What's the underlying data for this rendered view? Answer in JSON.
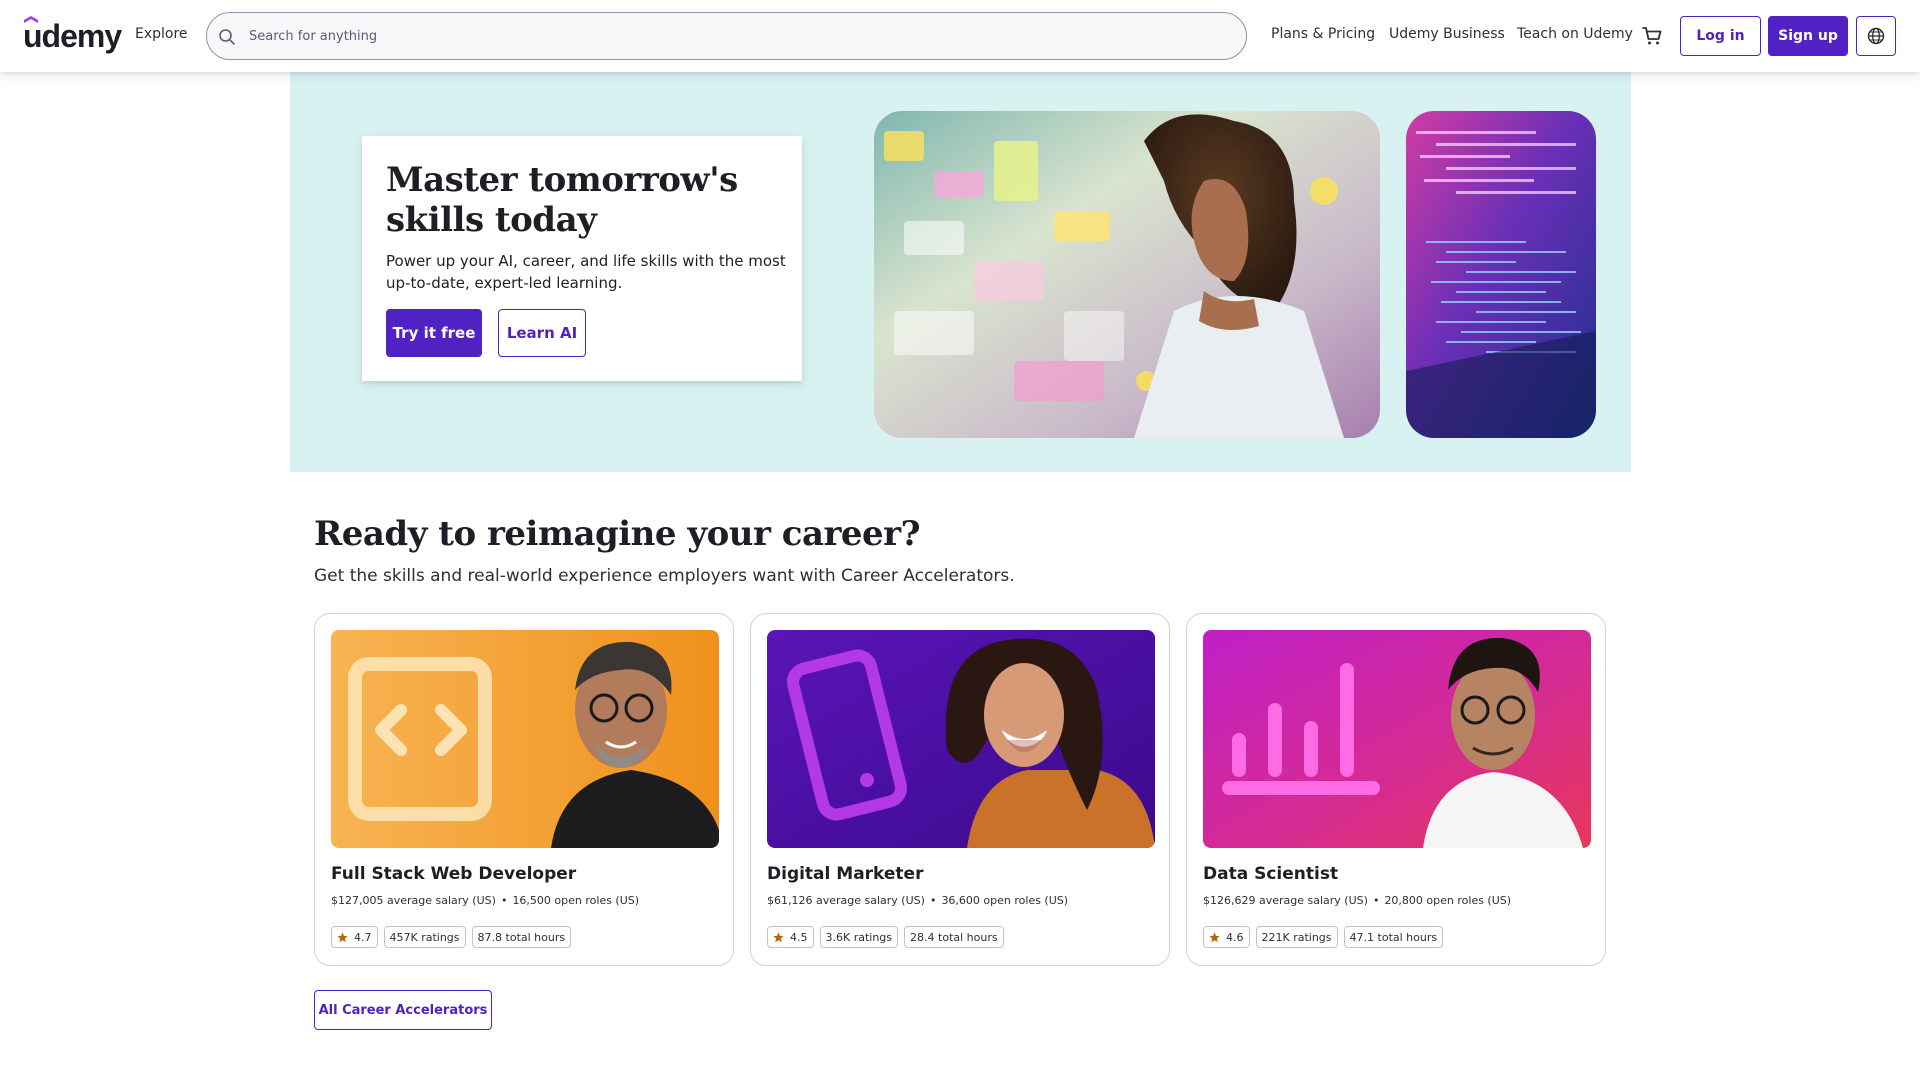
{
  "header": {
    "logo_text": "udemy",
    "explore_label": "Explore",
    "search_placeholder": "Search for anything",
    "search_value": "",
    "nav": {
      "plans": "Plans & Pricing",
      "business": "Udemy Business",
      "teach": "Teach on Udemy"
    },
    "login_label": "Log in",
    "signup_label": "Sign up"
  },
  "hero": {
    "title": "Master tomorrow's skills today",
    "subtitle": "Power up your AI, career, and life skills with the most up-to-date, expert-led learning.",
    "primary_button": "Try it free",
    "secondary_button": "Learn AI"
  },
  "career": {
    "title": "Ready to reimagine your career?",
    "subtitle": "Get the skills and real-world experience employers want with Career Accelerators.",
    "cards": [
      {
        "title": "Full Stack Web Developer",
        "salary": "$127,005 average salary (US)",
        "roles": "16,500 open roles (US)",
        "rating": "4.7",
        "ratings_count": "457K ratings",
        "hours": "87.8 total hours",
        "icon": "code-brackets-icon"
      },
      {
        "title": "Digital Marketer",
        "salary": "$61,126 average salary (US)",
        "roles": "36,600 open roles (US)",
        "rating": "4.5",
        "ratings_count": "3.6K ratings",
        "hours": "28.4 total hours",
        "icon": "smartphone-icon"
      },
      {
        "title": "Data Scientist",
        "salary": "$126,629 average salary (US)",
        "roles": "20,800 open roles (US)",
        "rating": "4.6",
        "ratings_count": "221K ratings",
        "hours": "47.1 total hours",
        "icon": "bar-chart-icon"
      }
    ],
    "all_button": "All Career Accelerators"
  },
  "colors": {
    "brand_purple": "#5022c3",
    "hero_bg": "#d8f1f1",
    "star": "#b4690e"
  }
}
